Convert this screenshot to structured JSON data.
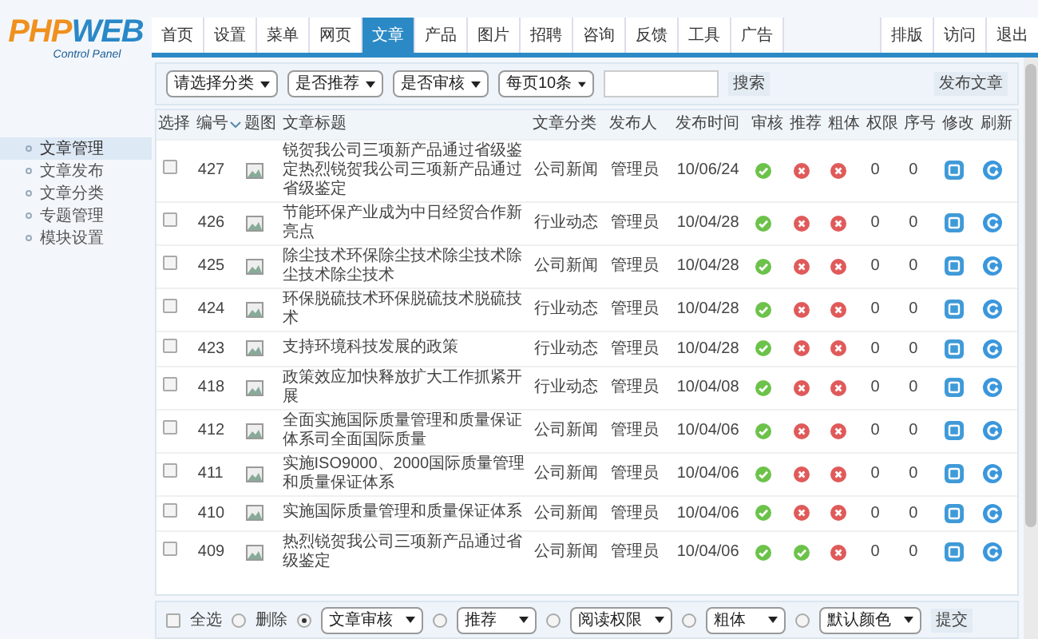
{
  "logo": {
    "title_parts": [
      "PHP",
      "WEB"
    ],
    "subtitle": "Control Panel"
  },
  "nav_tabs": [
    {
      "label": "首页",
      "selected": false
    },
    {
      "label": "设置",
      "selected": false
    },
    {
      "label": "菜单",
      "selected": false
    },
    {
      "label": "网页",
      "selected": false
    },
    {
      "label": "文章",
      "selected": true
    },
    {
      "label": "产品",
      "selected": false
    },
    {
      "label": "图片",
      "selected": false
    },
    {
      "label": "招聘",
      "selected": false
    },
    {
      "label": "咨询",
      "selected": false
    },
    {
      "label": "反馈",
      "selected": false
    },
    {
      "label": "工具",
      "selected": false
    },
    {
      "label": "广告",
      "selected": false
    }
  ],
  "right_tabs": [
    "排版",
    "访问",
    "退出"
  ],
  "sidebar": {
    "items": [
      {
        "label": "文章管理",
        "selected": true
      },
      {
        "label": "文章发布",
        "selected": false
      },
      {
        "label": "文章分类",
        "selected": false
      },
      {
        "label": "专题管理",
        "selected": false
      },
      {
        "label": "模块设置",
        "selected": false
      }
    ]
  },
  "filters": [
    "请选择分类",
    "是否推荐",
    "是否审核",
    "每页10条"
  ],
  "search_button": "搜索",
  "publish_button": "发布文章",
  "table": {
    "columns": [
      "选择",
      "编号",
      "题图",
      "文章标题",
      "文章分类",
      "发布人",
      "发布时间",
      "审核",
      "推荐",
      "粗体",
      "权限",
      "序号",
      "修改",
      "刷新"
    ],
    "rows": [
      {
        "checked": false,
        "id": "427",
        "title": "锐贺我公司三项新产品通过省级鉴定热烈锐贺我公司三项新产品通过省级鉴定",
        "category": "公司新闻",
        "author": "管理员",
        "date": "10/06/24",
        "audited": true,
        "recommended": false,
        "bold": false,
        "permission": "0",
        "order": "0"
      },
      {
        "checked": false,
        "id": "426",
        "title": "节能环保产业成为中日经贸合作新亮点",
        "category": "行业动态",
        "author": "管理员",
        "date": "10/04/28",
        "audited": true,
        "recommended": false,
        "bold": false,
        "permission": "0",
        "order": "0"
      },
      {
        "checked": false,
        "id": "425",
        "title": "除尘技术环保除尘技术除尘技术除尘技术除尘技术",
        "category": "公司新闻",
        "author": "管理员",
        "date": "10/04/28",
        "audited": true,
        "recommended": false,
        "bold": false,
        "permission": "0",
        "order": "0"
      },
      {
        "checked": false,
        "id": "424",
        "title": "环保脱硫技术环保脱硫技术脱硫技术",
        "category": "行业动态",
        "author": "管理员",
        "date": "10/04/28",
        "audited": true,
        "recommended": false,
        "bold": false,
        "permission": "0",
        "order": "0"
      },
      {
        "checked": false,
        "id": "423",
        "title": "支持环境科技发展的政策",
        "category": "行业动态",
        "author": "管理员",
        "date": "10/04/28",
        "audited": true,
        "recommended": false,
        "bold": false,
        "permission": "0",
        "order": "0"
      },
      {
        "checked": false,
        "id": "418",
        "title": "政策效应加快释放扩大工作抓紧开展",
        "category": "行业动态",
        "author": "管理员",
        "date": "10/04/08",
        "audited": true,
        "recommended": false,
        "bold": false,
        "permission": "0",
        "order": "0"
      },
      {
        "checked": false,
        "id": "412",
        "title": "全面实施国际质量管理和质量保证体系司全面国际质量",
        "category": "公司新闻",
        "author": "管理员",
        "date": "10/04/06",
        "audited": true,
        "recommended": false,
        "bold": false,
        "permission": "0",
        "order": "0"
      },
      {
        "checked": false,
        "id": "411",
        "title": "实施ISO9000、2000国际质量管理和质量保证体系",
        "category": "公司新闻",
        "author": "管理员",
        "date": "10/04/06",
        "audited": true,
        "recommended": false,
        "bold": false,
        "permission": "0",
        "order": "0"
      },
      {
        "checked": false,
        "id": "410",
        "title": "实施国际质量管理和质量保证体系",
        "category": "公司新闻",
        "author": "管理员",
        "date": "10/04/06",
        "audited": true,
        "recommended": false,
        "bold": false,
        "permission": "0",
        "order": "0"
      },
      {
        "checked": false,
        "id": "409",
        "title": "热烈锐贺我公司三项新产品通过省级鉴定",
        "category": "公司新闻",
        "author": "管理员",
        "date": "10/04/06",
        "audited": true,
        "recommended": true,
        "bold": false,
        "permission": "0",
        "order": "0"
      }
    ]
  },
  "bottom_bar": {
    "select_all": "全选",
    "select_all_checked": false,
    "options": [
      {
        "label": "删除",
        "kind": "radio",
        "selected": false
      },
      {
        "label": "文章审核",
        "kind": "select",
        "selected": true
      },
      {
        "label": "推荐",
        "kind": "select",
        "selected": false
      },
      {
        "label": "阅读权限",
        "kind": "select",
        "selected": false
      },
      {
        "label": "粗体",
        "kind": "select",
        "selected": false
      },
      {
        "label": "默认颜色",
        "kind": "select",
        "selected": false
      }
    ],
    "submit": "提交"
  }
}
